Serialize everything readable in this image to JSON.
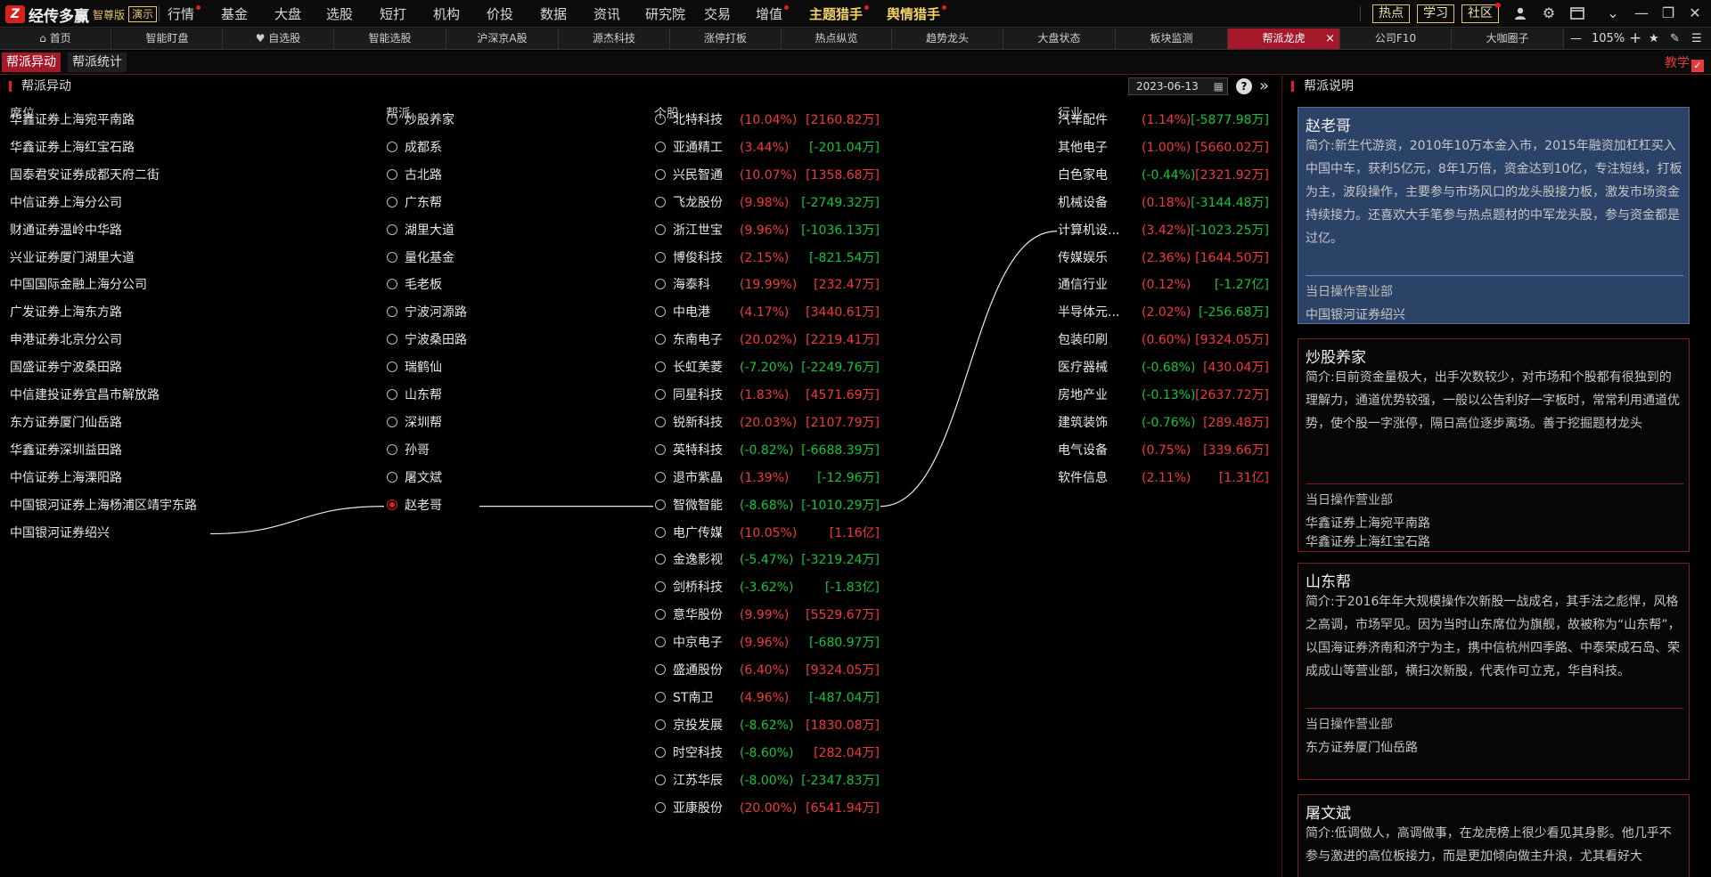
{
  "app": {
    "logo_mark": "Z",
    "name": "经传多赢",
    "edition": "智尊版",
    "demo_label": "演示"
  },
  "menu": {
    "items": [
      {
        "label": "行情",
        "dot": true
      },
      {
        "label": "基金",
        "dot": false
      },
      {
        "label": "大盘",
        "dot": false
      },
      {
        "label": "选股",
        "dot": false
      },
      {
        "label": "短打",
        "dot": false
      },
      {
        "label": "机构",
        "dot": false
      },
      {
        "label": "价投",
        "dot": false
      },
      {
        "label": "数据",
        "dot": false
      },
      {
        "label": "资讯",
        "dot": false
      },
      {
        "label": "研究院",
        "dot": false
      },
      {
        "label": "交易",
        "dot": false
      },
      {
        "label": "增值",
        "dot": true
      },
      {
        "label": "主题猎手",
        "dot": true
      },
      {
        "label": "舆情猎手",
        "dot": true
      }
    ],
    "right_buttons": [
      "热点",
      "学习",
      "社区"
    ]
  },
  "tabs": {
    "items": [
      "首页",
      "智能盯盘",
      "自选股",
      "智能选股",
      "沪深京A股",
      "源杰科技",
      "涨停打板",
      "热点纵览",
      "趋势龙头",
      "大盘状态",
      "板块监测",
      "帮派龙虎",
      "公司F10",
      "大咖圈子"
    ],
    "active": "帮派龙虎",
    "zoom": "105%"
  },
  "subtabs": {
    "items": [
      "帮派异动",
      "帮派统计"
    ],
    "active": "帮派异动",
    "teach_label": "教学"
  },
  "panel": {
    "title": "帮派异动",
    "date": "2023-06-13",
    "columns": {
      "seat": "席位",
      "gang": "帮派",
      "stock": "个股",
      "industry": "行业"
    }
  },
  "seats": [
    "华鑫证券上海宛平南路",
    "华鑫证券上海红宝石路",
    "国泰君安证券成都天府二街",
    "中信证券上海分公司",
    "财通证券温岭中华路",
    "兴业证券厦门湖里大道",
    "中国国际金融上海分公司",
    "广发证券上海东方路",
    "申港证券北京分公司",
    "国盛证券宁波桑田路",
    "中信建投证券宜昌市解放路",
    "东方证券厦门仙岳路",
    "华鑫证券深圳益田路",
    "中信证券上海溧阳路",
    "中国银河证券上海杨浦区靖宇东路",
    "中国银河证券绍兴"
  ],
  "gangs": [
    {
      "name": "炒股养家",
      "selected": false
    },
    {
      "name": "成都系",
      "selected": false
    },
    {
      "name": "古北路",
      "selected": false
    },
    {
      "name": "广东帮",
      "selected": false
    },
    {
      "name": "湖里大道",
      "selected": false
    },
    {
      "name": "量化基金",
      "selected": false
    },
    {
      "name": "毛老板",
      "selected": false
    },
    {
      "name": "宁波河源路",
      "selected": false
    },
    {
      "name": "宁波桑田路",
      "selected": false
    },
    {
      "name": "瑞鹤仙",
      "selected": false
    },
    {
      "name": "山东帮",
      "selected": false
    },
    {
      "name": "深圳帮",
      "selected": false
    },
    {
      "name": "孙哥",
      "selected": false
    },
    {
      "name": "屠文斌",
      "selected": false
    },
    {
      "name": "赵老哥",
      "selected": true
    }
  ],
  "stocks": [
    {
      "name": "北特科技",
      "pct": "(10.04%)",
      "amt": "[2160.82万]",
      "pct_dir": "up",
      "amt_dir": "up"
    },
    {
      "name": "亚通精工",
      "pct": "(3.44%)",
      "amt": "[-201.04万]",
      "pct_dir": "up",
      "amt_dir": "down"
    },
    {
      "name": "兴民智通",
      "pct": "(10.07%)",
      "amt": "[1358.68万]",
      "pct_dir": "up",
      "amt_dir": "up"
    },
    {
      "name": "飞龙股份",
      "pct": "(9.98%)",
      "amt": "[-2749.32万]",
      "pct_dir": "up",
      "amt_dir": "down"
    },
    {
      "name": "浙江世宝",
      "pct": "(9.96%)",
      "amt": "[-1036.13万]",
      "pct_dir": "up",
      "amt_dir": "down"
    },
    {
      "name": "博俊科技",
      "pct": "(2.15%)",
      "amt": "[-821.54万]",
      "pct_dir": "up",
      "amt_dir": "down"
    },
    {
      "name": "海泰科",
      "pct": "(19.99%)",
      "amt": "[232.47万]",
      "pct_dir": "up",
      "amt_dir": "up"
    },
    {
      "name": "中电港",
      "pct": "(4.17%)",
      "amt": "[3440.61万]",
      "pct_dir": "up",
      "amt_dir": "up"
    },
    {
      "name": "东南电子",
      "pct": "(20.02%)",
      "amt": "[2219.41万]",
      "pct_dir": "up",
      "amt_dir": "up"
    },
    {
      "name": "长虹美菱",
      "pct": "(-7.20%)",
      "amt": "[-2249.76万]",
      "pct_dir": "down",
      "amt_dir": "down"
    },
    {
      "name": "同星科技",
      "pct": "(1.83%)",
      "amt": "[4571.69万]",
      "pct_dir": "up",
      "amt_dir": "up"
    },
    {
      "name": "锐新科技",
      "pct": "(20.03%)",
      "amt": "[2107.79万]",
      "pct_dir": "up",
      "amt_dir": "up"
    },
    {
      "name": "英特科技",
      "pct": "(-0.82%)",
      "amt": "[-6688.39万]",
      "pct_dir": "down",
      "amt_dir": "down"
    },
    {
      "name": "退市紫晶",
      "pct": "(1.39%)",
      "amt": "[-12.96万]",
      "pct_dir": "up",
      "amt_dir": "down"
    },
    {
      "name": "智微智能",
      "pct": "(-8.68%)",
      "amt": "[-1010.29万]",
      "pct_dir": "down",
      "amt_dir": "down"
    },
    {
      "name": "电广传媒",
      "pct": "(10.05%)",
      "amt": "[1.16亿]",
      "pct_dir": "up",
      "amt_dir": "up"
    },
    {
      "name": "金逸影视",
      "pct": "(-5.47%)",
      "amt": "[-3219.24万]",
      "pct_dir": "down",
      "amt_dir": "down"
    },
    {
      "name": "剑桥科技",
      "pct": "(-3.62%)",
      "amt": "[-1.83亿]",
      "pct_dir": "down",
      "amt_dir": "down"
    },
    {
      "name": "意华股份",
      "pct": "(9.99%)",
      "amt": "[5529.67万]",
      "pct_dir": "up",
      "amt_dir": "up"
    },
    {
      "name": "中京电子",
      "pct": "(9.96%)",
      "amt": "[-680.97万]",
      "pct_dir": "up",
      "amt_dir": "down"
    },
    {
      "name": "盛通股份",
      "pct": "(6.40%)",
      "amt": "[9324.05万]",
      "pct_dir": "up",
      "amt_dir": "up"
    },
    {
      "name": "ST南卫",
      "pct": "(4.96%)",
      "amt": "[-487.04万]",
      "pct_dir": "up",
      "amt_dir": "down"
    },
    {
      "name": "京投发展",
      "pct": "(-8.62%)",
      "amt": "[1830.08万]",
      "pct_dir": "down",
      "amt_dir": "up"
    },
    {
      "name": "时空科技",
      "pct": "(-8.60%)",
      "amt": "[282.04万]",
      "pct_dir": "down",
      "amt_dir": "up"
    },
    {
      "name": "江苏华辰",
      "pct": "(-8.00%)",
      "amt": "[-2347.83万]",
      "pct_dir": "down",
      "amt_dir": "down"
    },
    {
      "name": "亚康股份",
      "pct": "(20.00%)",
      "amt": "[6541.94万]",
      "pct_dir": "up",
      "amt_dir": "up"
    }
  ],
  "industries": [
    {
      "name": "汽车配件",
      "pct": "(1.14%)",
      "amt": "[-5877.98万]",
      "pct_dir": "up",
      "amt_dir": "down"
    },
    {
      "name": "其他电子",
      "pct": "(1.00%)",
      "amt": "[5660.02万]",
      "pct_dir": "up",
      "amt_dir": "up"
    },
    {
      "name": "白色家电",
      "pct": "(-0.44%)",
      "amt": "[2321.92万]",
      "pct_dir": "down",
      "amt_dir": "up"
    },
    {
      "name": "机械设备",
      "pct": "(0.18%)",
      "amt": "[-3144.48万]",
      "pct_dir": "up",
      "amt_dir": "down"
    },
    {
      "name": "计算机设...",
      "pct": "(3.42%)",
      "amt": "[-1023.25万]",
      "pct_dir": "up",
      "amt_dir": "down"
    },
    {
      "name": "传媒娱乐",
      "pct": "(2.36%)",
      "amt": "[1644.50万]",
      "pct_dir": "up",
      "amt_dir": "up"
    },
    {
      "name": "通信行业",
      "pct": "(0.12%)",
      "amt": "[-1.27亿]",
      "pct_dir": "up",
      "amt_dir": "down"
    },
    {
      "name": "半导体元...",
      "pct": "(2.02%)",
      "amt": "[-256.68万]",
      "pct_dir": "up",
      "amt_dir": "down"
    },
    {
      "name": "包装印刷",
      "pct": "(0.60%)",
      "amt": "[9324.05万]",
      "pct_dir": "up",
      "amt_dir": "up"
    },
    {
      "name": "医疗器械",
      "pct": "(-0.68%)",
      "amt": "[430.04万]",
      "pct_dir": "down",
      "amt_dir": "up"
    },
    {
      "name": "房地产业",
      "pct": "(-0.13%)",
      "amt": "[2637.72万]",
      "pct_dir": "down",
      "amt_dir": "up"
    },
    {
      "name": "建筑装饰",
      "pct": "(-0.76%)",
      "amt": "[289.48万]",
      "pct_dir": "down",
      "amt_dir": "up"
    },
    {
      "name": "电气设备",
      "pct": "(0.75%)",
      "amt": "[339.66万]",
      "pct_dir": "up",
      "amt_dir": "up"
    },
    {
      "name": "软件信息",
      "pct": "(2.11%)",
      "amt": "[1.31亿]",
      "pct_dir": "up",
      "amt_dir": "up"
    }
  ],
  "links": {
    "seat": "中国银河证券绍兴",
    "gang": "赵老哥",
    "stock": "智微智能",
    "industry": "计算机设..."
  },
  "info": {
    "title": "帮派说明",
    "cards": [
      {
        "name": "赵老哥",
        "desc": "简介:新生代游资，2010年10万本金入市，2015年融资加杠杠买入中国中车，获利5亿元，8年1万倍，资金达到10亿，专注短线，打板为主，波段操作，主要参与市场风口的龙头股接力板，激发市场资金持续接力。还喜欢大手笔参与热点题材的中军龙头股，参与资金都是过亿。",
        "ops_label": "当日操作营业部",
        "ops": [
          "中国银河证券绍兴"
        ],
        "selected": true
      },
      {
        "name": "炒股养家",
        "desc": "简介:目前资金量极大，出手次数较少，对市场和个股都有很独到的理解力，通道优势较强，一般以公告利好一字板时，常常利用通道优势，使个股一字涨停，隔日高位逐步离场。善于挖掘题材龙头",
        "ops_label": "当日操作营业部",
        "ops": [
          "华鑫证券上海宛平南路",
          "华鑫证券上海红宝石路"
        ],
        "selected": false
      },
      {
        "name": "山东帮",
        "desc": "简介:于2016年年大规模操作次新股一战成名，其手法之彪悍，风格之高调，市场罕见。因为当时山东席位为旗舰，故被称为“山东帮”，以国海证券济南和济宁为主，携中信杭州四季路、中泰荣成石岛、荣成成山等营业部，横扫次新股，代表作可立克，华自科技。",
        "ops_label": "当日操作营业部",
        "ops": [
          "东方证券厦门仙岳路"
        ],
        "selected": false
      },
      {
        "name": "屠文斌",
        "desc": "简介:低调做人，高调做事，在龙虎榜上很少看见其身影。他几乎不参与激进的高位板接力，而是更加倾向做主升浪，尤其看好大",
        "ops_label": "",
        "ops": [],
        "selected": false
      }
    ]
  },
  "colors": {
    "up": "#f23a3a",
    "down": "#16c43a",
    "accent": "#a5192a",
    "link_line": "#e8e8e8"
  }
}
